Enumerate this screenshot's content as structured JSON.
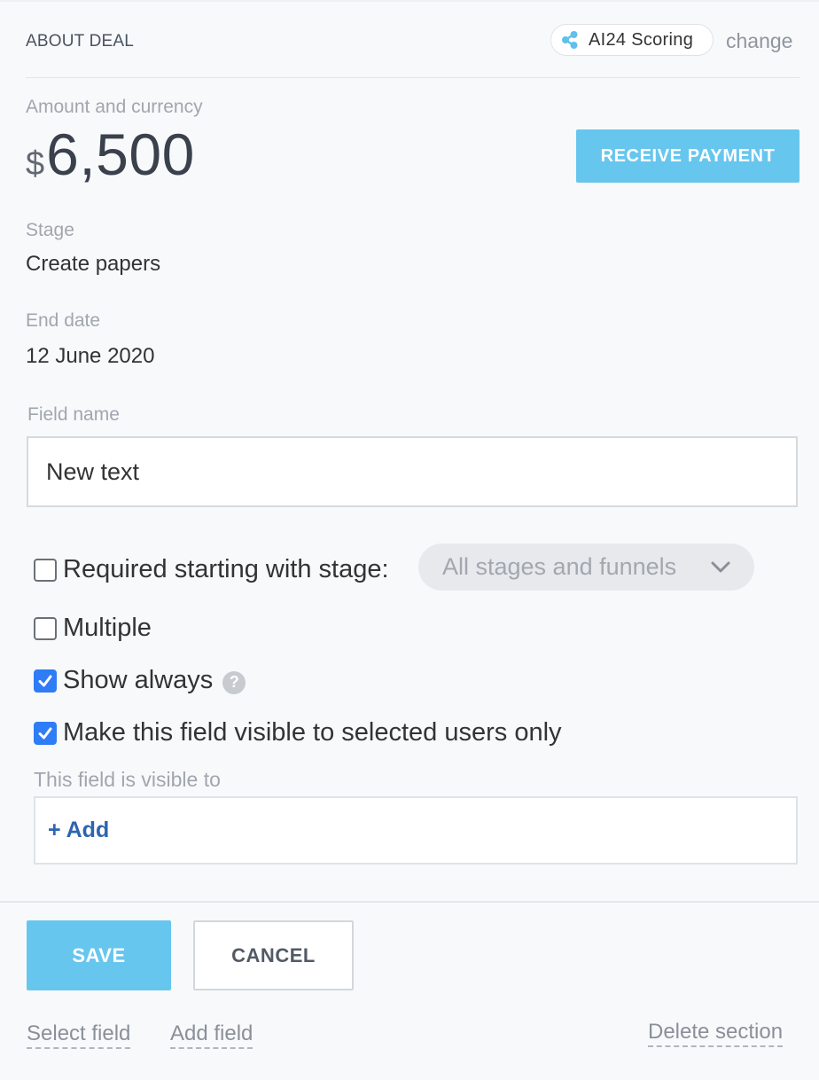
{
  "header": {
    "title": "ABOUT DEAL",
    "scoring_label": "AI24 Scoring",
    "change_label": "change"
  },
  "amount": {
    "label": "Amount and currency",
    "currency": "$",
    "value": "6,500",
    "receive_payment_label": "RECEIVE PAYMENT"
  },
  "stage": {
    "label": "Stage",
    "value": "Create papers"
  },
  "end_date": {
    "label": "End date",
    "value": "12 June 2020"
  },
  "field_editor": {
    "field_name_label": "Field name",
    "field_name_value": "New text",
    "required_label": "Required starting with stage:",
    "required_checked": false,
    "stage_select_value": "All stages and funnels",
    "multiple_label": "Multiple",
    "multiple_checked": false,
    "show_always_label": "Show always",
    "show_always_checked": true,
    "help_icon_glyph": "?",
    "visible_selected_label": "Make this field visible to selected users only",
    "visible_selected_checked": true,
    "visible_to_label": "This field is visible to",
    "add_label": "+ Add"
  },
  "footer": {
    "save_label": "SAVE",
    "cancel_label": "CANCEL",
    "select_field_label": "Select field",
    "add_field_label": "Add field",
    "delete_section_label": "Delete section"
  },
  "colors": {
    "accent_button": "#67c6ee",
    "checkbox_checked": "#2e7cf6",
    "link_blue": "#2e64b0"
  }
}
